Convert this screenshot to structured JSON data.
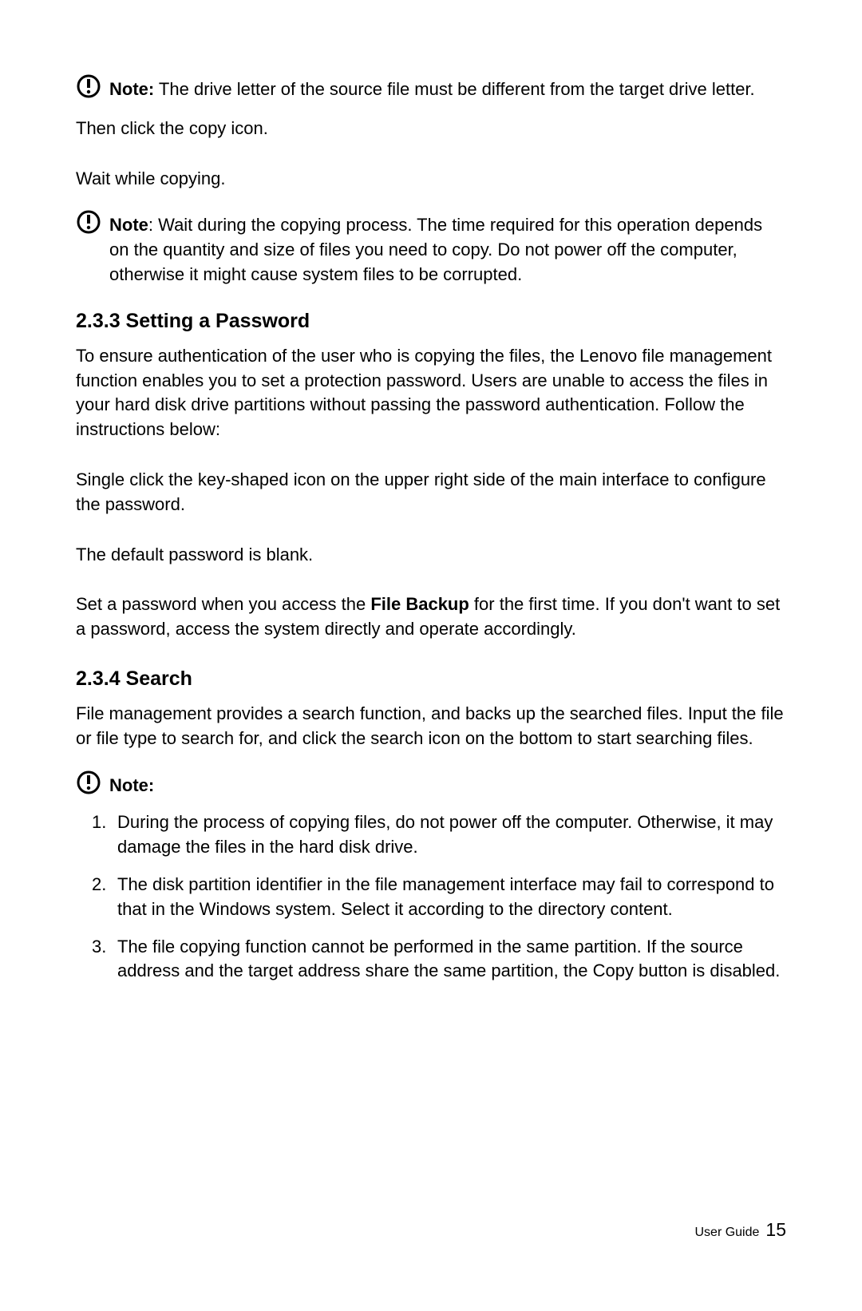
{
  "note1": {
    "label": "Note:",
    "text": " The drive letter of the source file must be different from the target drive letter."
  },
  "para1": "Then click the copy icon.",
  "para2": "Wait while copying.",
  "note2": {
    "label": "Note",
    "text": ": Wait during the copying process. The time required for this operation depends on the quantity and size of files you need to copy. Do not power off the computer, otherwise it might cause system files to be corrupted."
  },
  "heading1": "2.3.3 Setting a Password",
  "para3": "To ensure authentication of the user who is copying the files, the Lenovo file management function enables you to set a protection password. Users are unable to access the files in your hard disk drive partitions without passing the password authentication. Follow the instructions below:",
  "para4": "Single click the key-shaped icon on the upper right side of the main interface to configure the password.",
  "para5": "The default password is blank.",
  "para6_pre": "Set a password when you access the ",
  "para6_bold": "File Backup",
  "para6_post": " for the first time. If you don't want to set a password, access the system directly and operate accordingly.",
  "heading2": "2.3.4 Search",
  "para7": "File management provides a search function, and backs up the searched files. Input the file or file type to search for, and click the search icon on the bottom to start searching files.",
  "note3": {
    "label": "Note:"
  },
  "list": {
    "item1": "During the process of copying files, do not power off the computer. Otherwise, it may damage the files in the hard disk drive.",
    "item2": "The disk partition identifier in the file management interface may fail to correspond to that in the Windows system. Select it according to the directory content.",
    "item3": "The file copying function cannot be performed in the same partition. If the source address and the target address share the same partition, the Copy button is disabled."
  },
  "footer_label": "User Guide",
  "page_number": "15"
}
